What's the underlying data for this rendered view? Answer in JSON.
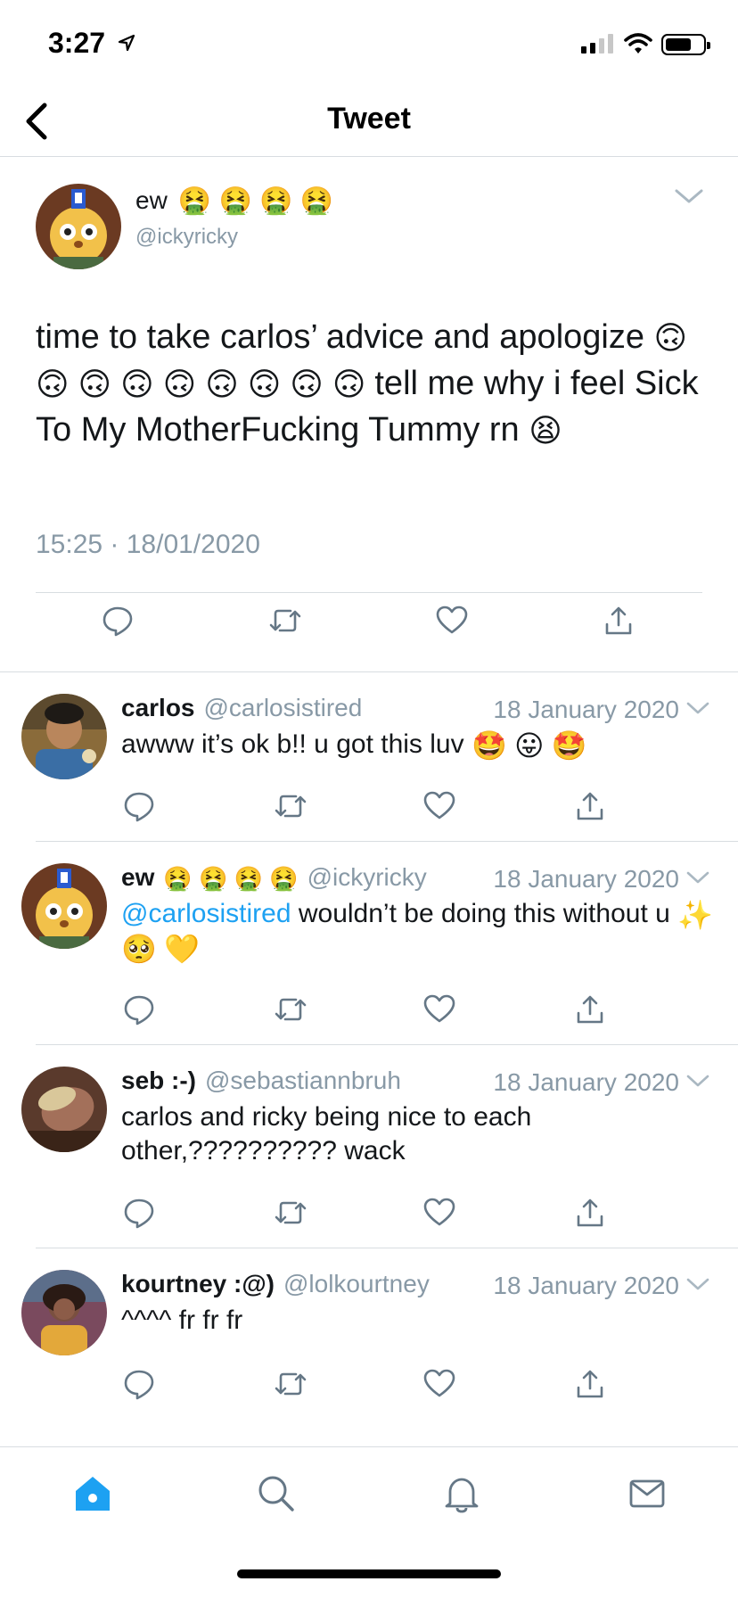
{
  "status_bar": {
    "time": "3:27"
  },
  "nav": {
    "title": "Tweet"
  },
  "main_tweet": {
    "name": "ew",
    "name_emojis": [
      "🤮",
      "🤮",
      "🤮",
      "🤮"
    ],
    "handle": "@ickyricky",
    "text_part1": "time to take carlos’ advice and apologize",
    "upside_down_emojis": [
      "🙃",
      "🙃",
      "🙃",
      "🙃",
      "🙃",
      "🙃",
      "🙃",
      "🙃",
      "🙃"
    ],
    "text_part2": "tell me why i feel Sick To My MotherFucking Tummy rn",
    "end_emoji": "😫",
    "timestamp": "15:25 · 18/01/2020"
  },
  "replies": [
    {
      "name": "carlos",
      "handle": "@carlosistired",
      "date": "18 January 2020",
      "text": "awww it’s ok b!! u got this luv",
      "emojis": [
        "🤩",
        "😛",
        "🤩"
      ]
    },
    {
      "name": "ew",
      "name_emojis": [
        "🤮",
        "🤮",
        "🤮",
        "🤮"
      ],
      "handle": "@ickyricky",
      "date": "18 January 2020",
      "mention": "@carlosistired",
      "text": "wouldn’t be doing this without u",
      "emojis": [
        "✨",
        "🥺",
        "💛"
      ]
    },
    {
      "name": "seb :-)",
      "handle": "@sebastiannbruh",
      "date": "18 January 2020",
      "text": "carlos and ricky being nice to each other,?????????? wack"
    },
    {
      "name": "kourtney :@)",
      "handle": "@lolkourtney",
      "date": "18 January 2020",
      "text": "^^^^ fr fr fr"
    }
  ],
  "icons": {
    "reply": "reply-icon",
    "retweet": "retweet-icon",
    "like": "heart-icon",
    "share": "share-icon",
    "tabs": [
      "home-icon",
      "search-icon",
      "notifications-icon",
      "messages-icon"
    ]
  },
  "colors": {
    "accent": "#1da1f2",
    "muted": "#8899a6",
    "text": "#14171a",
    "divider": "#d8dde1"
  }
}
